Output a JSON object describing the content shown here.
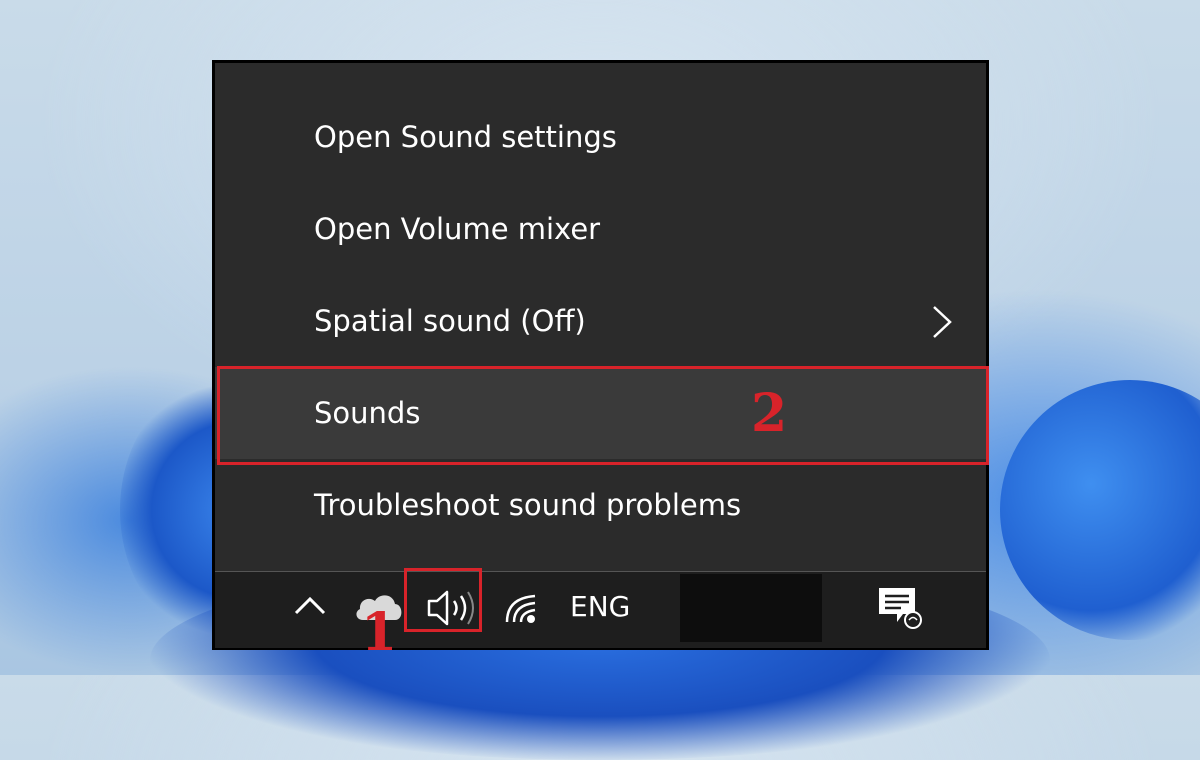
{
  "menu": {
    "items": [
      {
        "label": "Open Sound settings"
      },
      {
        "label": "Open Volume mixer"
      },
      {
        "label": "Spatial sound (Off)",
        "has_submenu": true
      },
      {
        "label": "Sounds",
        "highlighted": true
      },
      {
        "label": "Troubleshoot sound problems"
      }
    ]
  },
  "taskbar": {
    "icons": [
      "chevron-up-icon",
      "onedrive-cloud-icon",
      "speaker-volume-icon",
      "wifi-icon",
      "notification-center-icon"
    ],
    "language": "ENG"
  },
  "annotations": {
    "step1": "1",
    "step2": "2",
    "highlight_color": "#d8232a"
  }
}
